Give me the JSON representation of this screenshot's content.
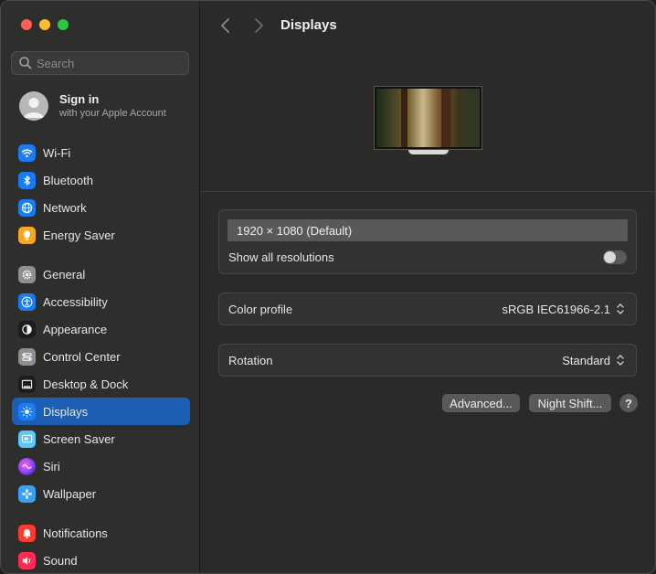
{
  "window": {
    "traffic_lights": {
      "close": "#ff5f57",
      "minimize": "#febc2e",
      "maximize": "#28c840"
    }
  },
  "sidebar": {
    "search": {
      "placeholder": "Search",
      "value": ""
    },
    "account": {
      "title": "Sign in",
      "subtitle": "with your Apple Account"
    },
    "groups": [
      [
        {
          "label": "Wi-Fi",
          "icon": "wifi-icon",
          "color": "#1a7cf5"
        },
        {
          "label": "Bluetooth",
          "icon": "bluetooth-icon",
          "color": "#1a7cf5"
        },
        {
          "label": "Network",
          "icon": "globe-icon",
          "color": "#1a7cf5"
        },
        {
          "label": "Energy Saver",
          "icon": "lightbulb-icon",
          "color": "#f5a623"
        }
      ],
      [
        {
          "label": "General",
          "icon": "gear-icon",
          "color": "#8e8e93"
        },
        {
          "label": "Accessibility",
          "icon": "accessibility-icon",
          "color": "#1a7cf5"
        },
        {
          "label": "Appearance",
          "icon": "appearance-icon",
          "color": "#1c1c1e"
        },
        {
          "label": "Control Center",
          "icon": "control-center-icon",
          "color": "#8e8e93"
        },
        {
          "label": "Desktop & Dock",
          "icon": "dock-icon",
          "color": "#1c1c1e"
        },
        {
          "label": "Displays",
          "icon": "sun-icon",
          "color": "#1a7cf5",
          "active": true
        },
        {
          "label": "Screen Saver",
          "icon": "screen-saver-icon",
          "color": "#5ac8fa"
        },
        {
          "label": "Siri",
          "icon": "siri-icon",
          "color": "#c83cdc"
        },
        {
          "label": "Wallpaper",
          "icon": "wallpaper-icon",
          "color": "#3aa0f5"
        }
      ],
      [
        {
          "label": "Notifications",
          "icon": "bell-icon",
          "color": "#ff3b30"
        },
        {
          "label": "Sound",
          "icon": "speaker-icon",
          "color": "#ff2d55"
        }
      ]
    ]
  },
  "main": {
    "title": "Displays",
    "resolution": {
      "selected": "1920 × 1080 (Default)",
      "show_all_label": "Show all resolutions",
      "show_all_enabled": false
    },
    "color_profile": {
      "label": "Color profile",
      "value": "sRGB IEC61966-2.1"
    },
    "rotation": {
      "label": "Rotation",
      "value": "Standard"
    },
    "buttons": {
      "advanced": "Advanced...",
      "night_shift": "Night Shift...",
      "help": "?"
    }
  }
}
